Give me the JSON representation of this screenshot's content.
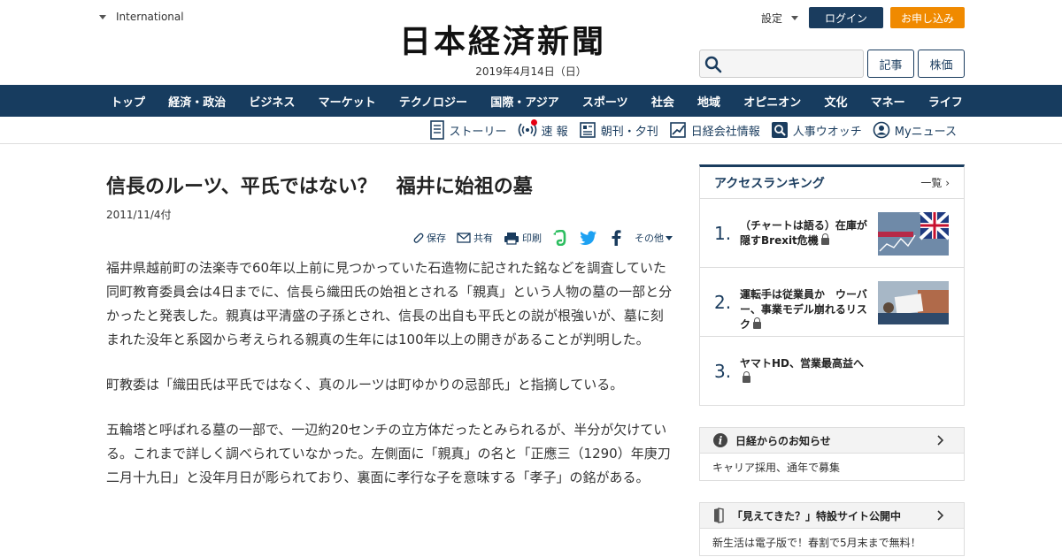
{
  "header": {
    "edition": "International",
    "logo": "日本経済新聞",
    "date": "2019年4月14日（日）",
    "settings": "設定",
    "login": "ログイン",
    "signup": "お申し込み",
    "search_placeholder": "",
    "kiji": "記事",
    "kabuka": "株価"
  },
  "nav": [
    "トップ",
    "経済・政治",
    "ビジネス",
    "マーケット",
    "テクノロジー",
    "国際・アジア",
    "スポーツ",
    "社会",
    "地域",
    "オピニオン",
    "文化",
    "マネー",
    "ライフ"
  ],
  "subnav": {
    "story": "ストーリー",
    "flash": "速 報",
    "morning_evening": "朝刊・夕刊",
    "company_info": "日経会社情報",
    "personnel": "人事ウオッチ",
    "my_news": "Myニュース"
  },
  "article": {
    "title": "信長のルーツ、平氏ではない？　福井に始祖の墓",
    "date": "2011/11/4付",
    "tools": {
      "save": "保存",
      "share": "共有",
      "print": "印刷",
      "more": "その他"
    },
    "paragraphs": [
      "福井県越前町の法楽寺で60年以上前に見つかっていた石造物に記された銘などを調査していた同町教育委員会は4日までに、信長ら織田氏の始祖とされる「親真」という人物の墓の一部と分かったと発表した。親真は平清盛の子孫とされ、信長の出自も平氏との説が根強いが、墓に刻まれた没年と系図から考えられる親真の生年には100年以上の開きがあることが判明した。",
      "町教委は「織田氏は平氏ではなく、真のルーツは町ゆかりの忌部氏」と指摘している。",
      "五輪塔と呼ばれる墓の一部で、一辺約20センチの立方体だったとみられるが、半分が欠けている。これまで詳しく調べられていなかった。左側面に「親真」の名と「正應三（1290）年庚刀二月十九日」と没年月日が彫られており、裏面に孝行な子を意味する「孝子」の銘がある。"
    ]
  },
  "ranking": {
    "title": "アクセスランキング",
    "more": "一覧",
    "items": [
      {
        "num": "1.",
        "text": "（チャートは語る）在庫が隠すBrexit危機"
      },
      {
        "num": "2.",
        "text": "運転手は従業員か　ウーバー、事業モデル崩れるリスク"
      },
      {
        "num": "3.",
        "text": "ヤマトHD、営業最高益へ"
      }
    ]
  },
  "notice": {
    "title": "日経からのお知らせ",
    "body": "キャリア採用、通年で募集"
  },
  "special": {
    "title": "「見えてきた？」特設サイト公開中",
    "body": "新生活は電子版で！春割で5月末まで無料！"
  },
  "colors": {
    "navy": "#173c5f",
    "orange": "#f08a00",
    "red_dot": "#e60012"
  }
}
